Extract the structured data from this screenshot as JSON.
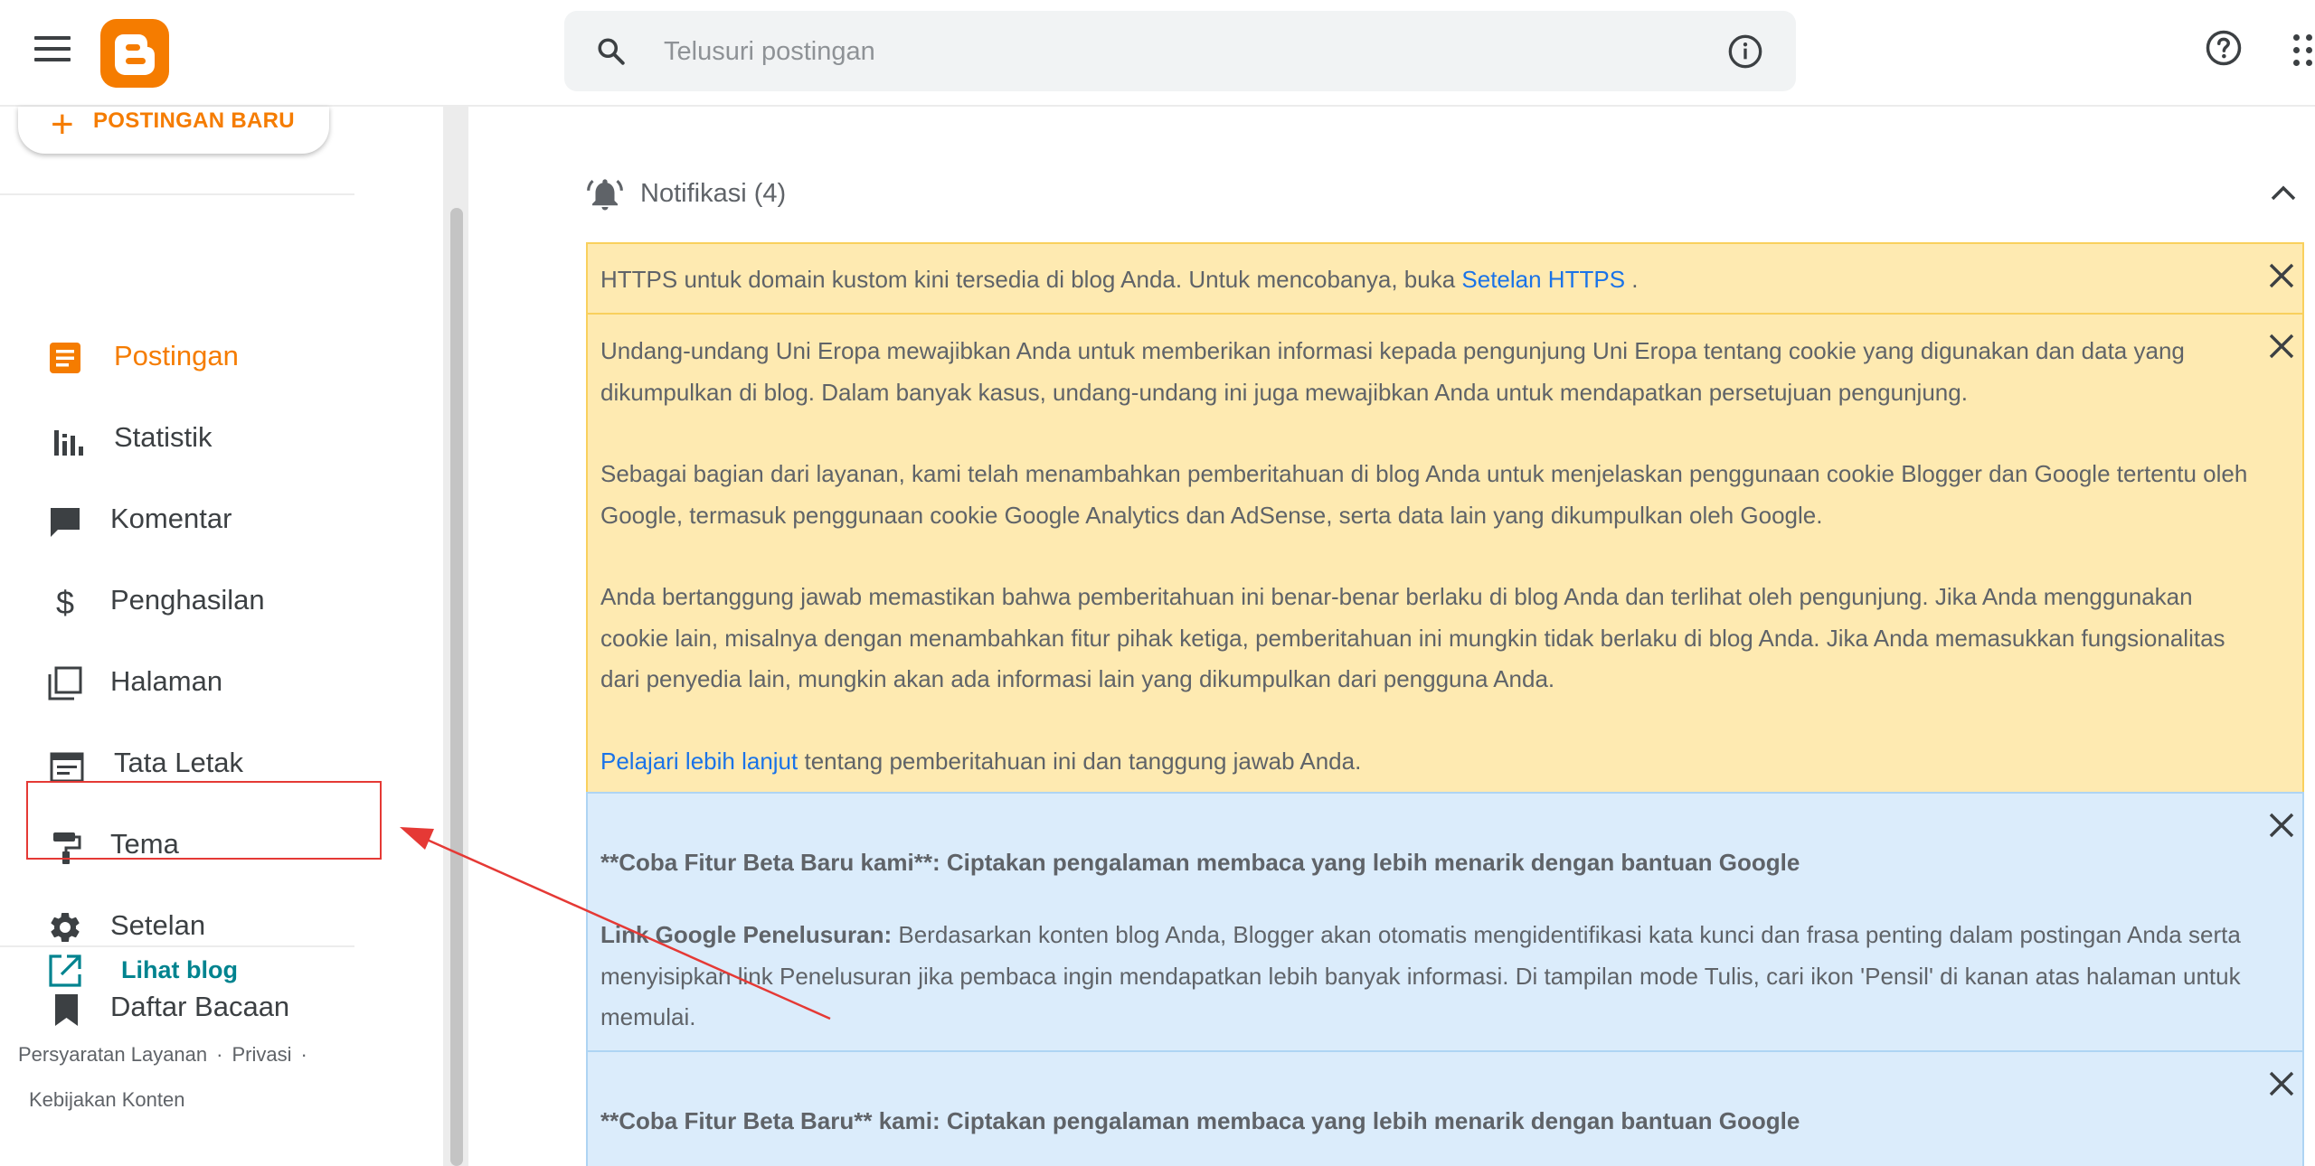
{
  "header": {
    "search_placeholder": "Telusuri postingan"
  },
  "sidebar": {
    "new_post_label": "POSTINGAN BARU",
    "items": [
      {
        "label": "Postingan",
        "icon": "posts-icon",
        "active": true
      },
      {
        "label": "Statistik",
        "icon": "stats-icon"
      },
      {
        "label": "Komentar",
        "icon": "comment-icon"
      },
      {
        "label": "Penghasilan",
        "icon": "dollar-icon"
      },
      {
        "label": "Halaman",
        "icon": "pages-icon"
      },
      {
        "label": "Tata Letak",
        "icon": "layout-icon"
      },
      {
        "label": "Tema",
        "icon": "paint-roller-icon"
      },
      {
        "label": "Setelan",
        "icon": "gear-icon",
        "highlighted": true
      },
      {
        "label": "Daftar Bacaan",
        "icon": "bookmark-icon"
      }
    ],
    "view_blog_label": "Lihat blog",
    "footer": {
      "terms": "Persyaratan Layanan",
      "privacy": "Privasi",
      "content_policy": "Kebijakan Konten",
      "separator": "·"
    }
  },
  "notifications": {
    "title": "Notifikasi (4)",
    "https": {
      "text_before": "HTTPS untuk domain kustom kini tersedia di blog Anda. Untuk mencobanya, buka ",
      "link": "Setelan HTTPS",
      "text_after": " ."
    },
    "cookie": {
      "p1": "Undang-undang Uni Eropa mewajibkan Anda untuk memberikan informasi kepada pengunjung Uni Eropa tentang cookie yang digunakan dan data yang dikumpulkan di blog. Dalam banyak kasus, undang-undang ini juga mewajibkan Anda untuk mendapatkan persetujuan pengunjung.",
      "p2": "Sebagai bagian dari layanan, kami telah menambahkan pemberitahuan di blog Anda untuk menjelaskan penggunaan cookie Blogger dan Google tertentu oleh Google, termasuk penggunaan cookie Google Analytics dan AdSense, serta data lain yang dikumpulkan oleh Google.",
      "p3": "Anda bertanggung jawab memastikan bahwa pemberitahuan ini benar-benar berlaku di blog Anda dan terlihat oleh pengunjung. Jika Anda menggunakan cookie lain, misalnya dengan menambahkan fitur pihak ketiga, pemberitahuan ini mungkin tidak berlaku di blog Anda. Jika Anda memasukkan fungsionalitas dari penyedia lain, mungkin akan ada informasi lain yang dikumpulkan dari pengguna Anda.",
      "learn_more_link": "Pelajari lebih lanjut",
      "learn_more_text": " tentang pemberitahuan ini dan tanggung jawab Anda."
    },
    "beta1": {
      "heading": "**Coba Fitur Beta Baru kami**: Ciptakan pengalaman membaca yang lebih menarik dengan bantuan Google",
      "label": "Link Google Penelusuran:",
      "body": " Berdasarkan konten blog Anda, Blogger akan otomatis mengidentifikasi kata kunci dan frasa penting dalam postingan Anda serta menyisipkan link Penelusuran jika pembaca ingin mendapatkan lebih banyak informasi. Di tampilan mode Tulis, cari ikon 'Pensil' di kanan atas halaman untuk memulai."
    },
    "beta2": {
      "heading": "**Coba Fitur Beta Baru** kami: Ciptakan pengalaman membaca yang lebih menarik dengan bantuan Google"
    }
  },
  "colors": {
    "brand_orange": "#f57c00",
    "link_blue": "#1a73e8",
    "teal": "#00838f",
    "annotation_red": "#e53935",
    "warning_bg": "#feeab1",
    "info_bg": "#dbecfb"
  }
}
